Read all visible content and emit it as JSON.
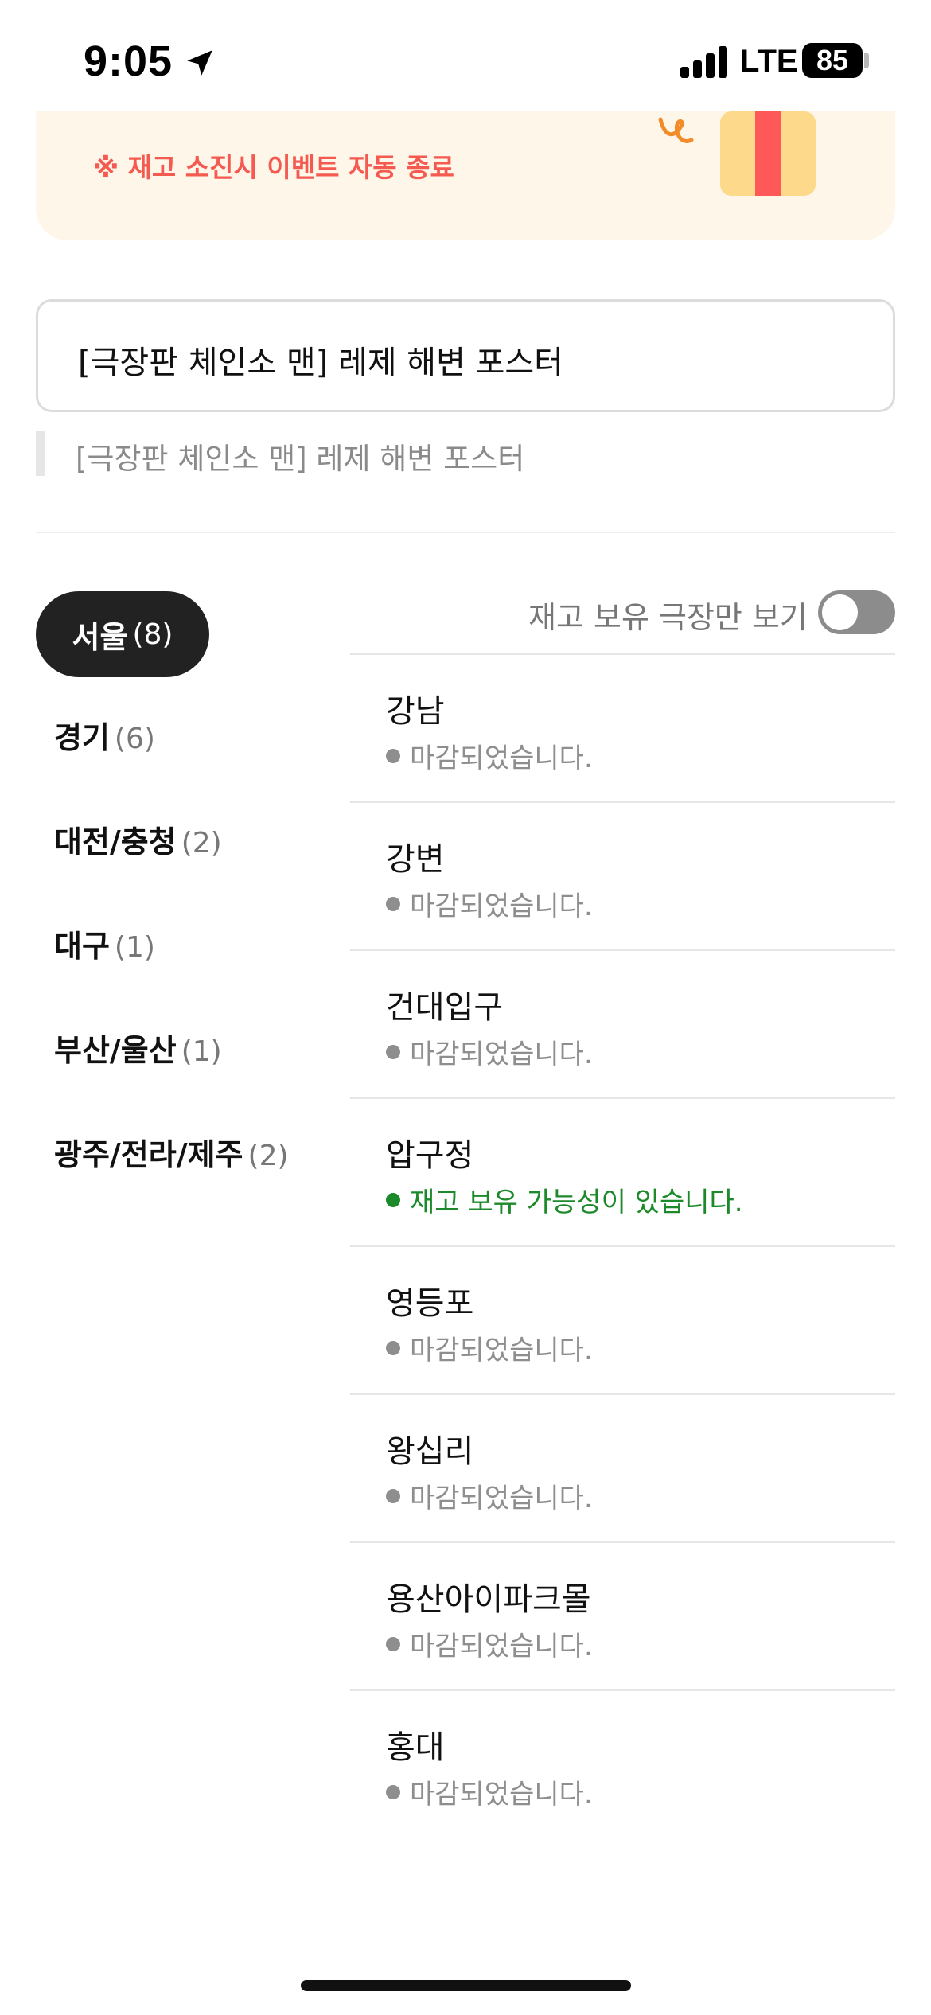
{
  "status_bar": {
    "time": "9:05",
    "network": "LTE",
    "battery": "85",
    "location_icon": "location-arrow-icon",
    "signal_icon": "signal-bars-icon"
  },
  "banner": {
    "note": "※ 재고 소진시 이벤트 자동 종료",
    "icon": "gift-box-icon",
    "colors": {
      "background": "#fff6ea",
      "accent": "#f45a50"
    }
  },
  "poster": {
    "title": "[극장판 체인소 맨] 레제 해변 포스터",
    "subtitle": "[극장판 체인소 맨] 레제 해변 포스터"
  },
  "filter": {
    "toggle_label": "재고 보유 극장만 보기",
    "toggle_on": false
  },
  "regions": [
    {
      "name": "서울",
      "count": "(8)",
      "selected": true
    },
    {
      "name": "경기",
      "count": "(6)",
      "selected": false
    },
    {
      "name": "대전/충청",
      "count": "(2)",
      "selected": false
    },
    {
      "name": "대구",
      "count": "(1)",
      "selected": false
    },
    {
      "name": "부산/울산",
      "count": "(1)",
      "selected": false
    },
    {
      "name": "광주/전라/제주",
      "count": "(2)",
      "selected": false
    }
  ],
  "theaters": [
    {
      "name": "강남",
      "status": "마감되었습니다.",
      "available": false
    },
    {
      "name": "강변",
      "status": "마감되었습니다.",
      "available": false
    },
    {
      "name": "건대입구",
      "status": "마감되었습니다.",
      "available": false
    },
    {
      "name": "압구정",
      "status": "재고 보유 가능성이 있습니다.",
      "available": true
    },
    {
      "name": "영등포",
      "status": "마감되었습니다.",
      "available": false
    },
    {
      "name": "왕십리",
      "status": "마감되었습니다.",
      "available": false
    },
    {
      "name": "용산아이파크몰",
      "status": "마감되었습니다.",
      "available": false
    },
    {
      "name": "홍대",
      "status": "마감되었습니다.",
      "available": false
    }
  ],
  "colors": {
    "available": "#1c8a2a",
    "closed": "#8e8e8e",
    "selected_pill": "#222222"
  }
}
